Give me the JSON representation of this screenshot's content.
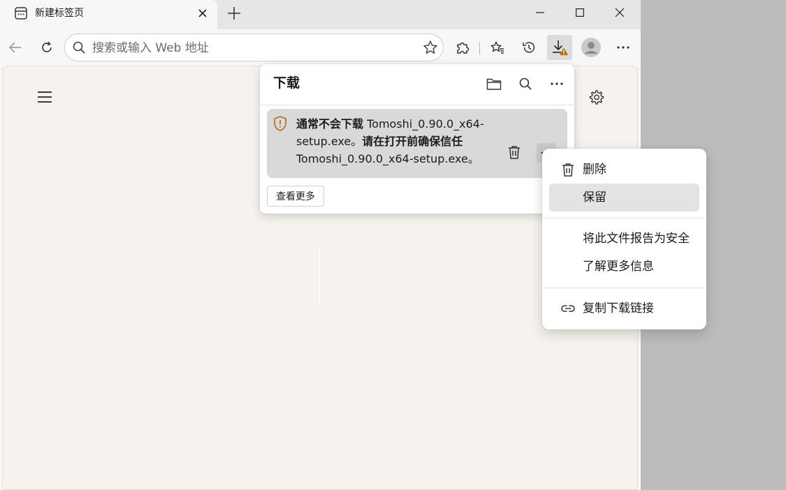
{
  "tab": {
    "title": "新建标签页",
    "favicon": "new-tab-page-icon"
  },
  "toolbar": {
    "address_placeholder": "搜索或输入 Web 地址",
    "download_warning_badge": "!"
  },
  "downloads": {
    "title": "下载",
    "item": {
      "message_bold_1": "通常不会下载",
      "message_normal_1": " Tomoshi_0.90.0_x64-setup.exe。",
      "message_bold_2": "请在打开前确保信任",
      "message_normal_2": " Tomoshi_0.90.0_x64-setup.exe。",
      "more": "..."
    },
    "see_more": "查看更多"
  },
  "context_menu": {
    "items": [
      {
        "label": "删除",
        "icon": "trash-icon"
      },
      {
        "label": "保留",
        "icon": ""
      },
      {
        "label": "将此文件报告为安全",
        "icon": ""
      },
      {
        "label": "了解更多信息",
        "icon": ""
      },
      {
        "label": "复制下载链接",
        "icon": "link-icon"
      }
    ]
  },
  "colors": {
    "warning": "#b46d0b",
    "hover": "#e3e3e3",
    "content_bg": "#f6f3ef"
  }
}
